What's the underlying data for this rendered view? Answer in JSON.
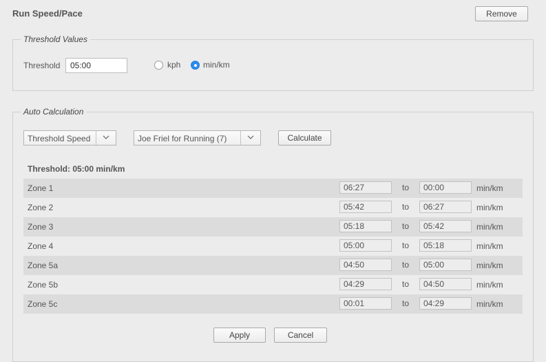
{
  "header": {
    "title": "Run Speed/Pace",
    "remove_label": "Remove"
  },
  "threshold_values": {
    "legend": "Threshold Values",
    "threshold_label": "Threshold",
    "threshold_value": "05:00",
    "units": [
      {
        "label": "kph",
        "selected": false
      },
      {
        "label": "min/km",
        "selected": true
      }
    ]
  },
  "auto_calc": {
    "legend": "Auto Calculation",
    "method_select": "Threshold Speed",
    "model_select": "Joe Friel for Running (7)",
    "calculate_label": "Calculate",
    "threshold_heading": "Threshold: 05:00 min/km",
    "to_label": "to",
    "unit_label": "min/km",
    "zones": [
      {
        "name": "Zone 1",
        "from": "06:27",
        "to": "00:00"
      },
      {
        "name": "Zone 2",
        "from": "05:42",
        "to": "06:27"
      },
      {
        "name": "Zone 3",
        "from": "05:18",
        "to": "05:42"
      },
      {
        "name": "Zone 4",
        "from": "05:00",
        "to": "05:18"
      },
      {
        "name": "Zone 5a",
        "from": "04:50",
        "to": "05:00"
      },
      {
        "name": "Zone 5b",
        "from": "04:29",
        "to": "04:50"
      },
      {
        "name": "Zone 5c",
        "from": "00:01",
        "to": "04:29"
      }
    ],
    "apply_label": "Apply",
    "cancel_label": "Cancel"
  },
  "colors": {
    "radio_selected": "#2c8cf2",
    "row_stripe": "#dcdcdc"
  }
}
